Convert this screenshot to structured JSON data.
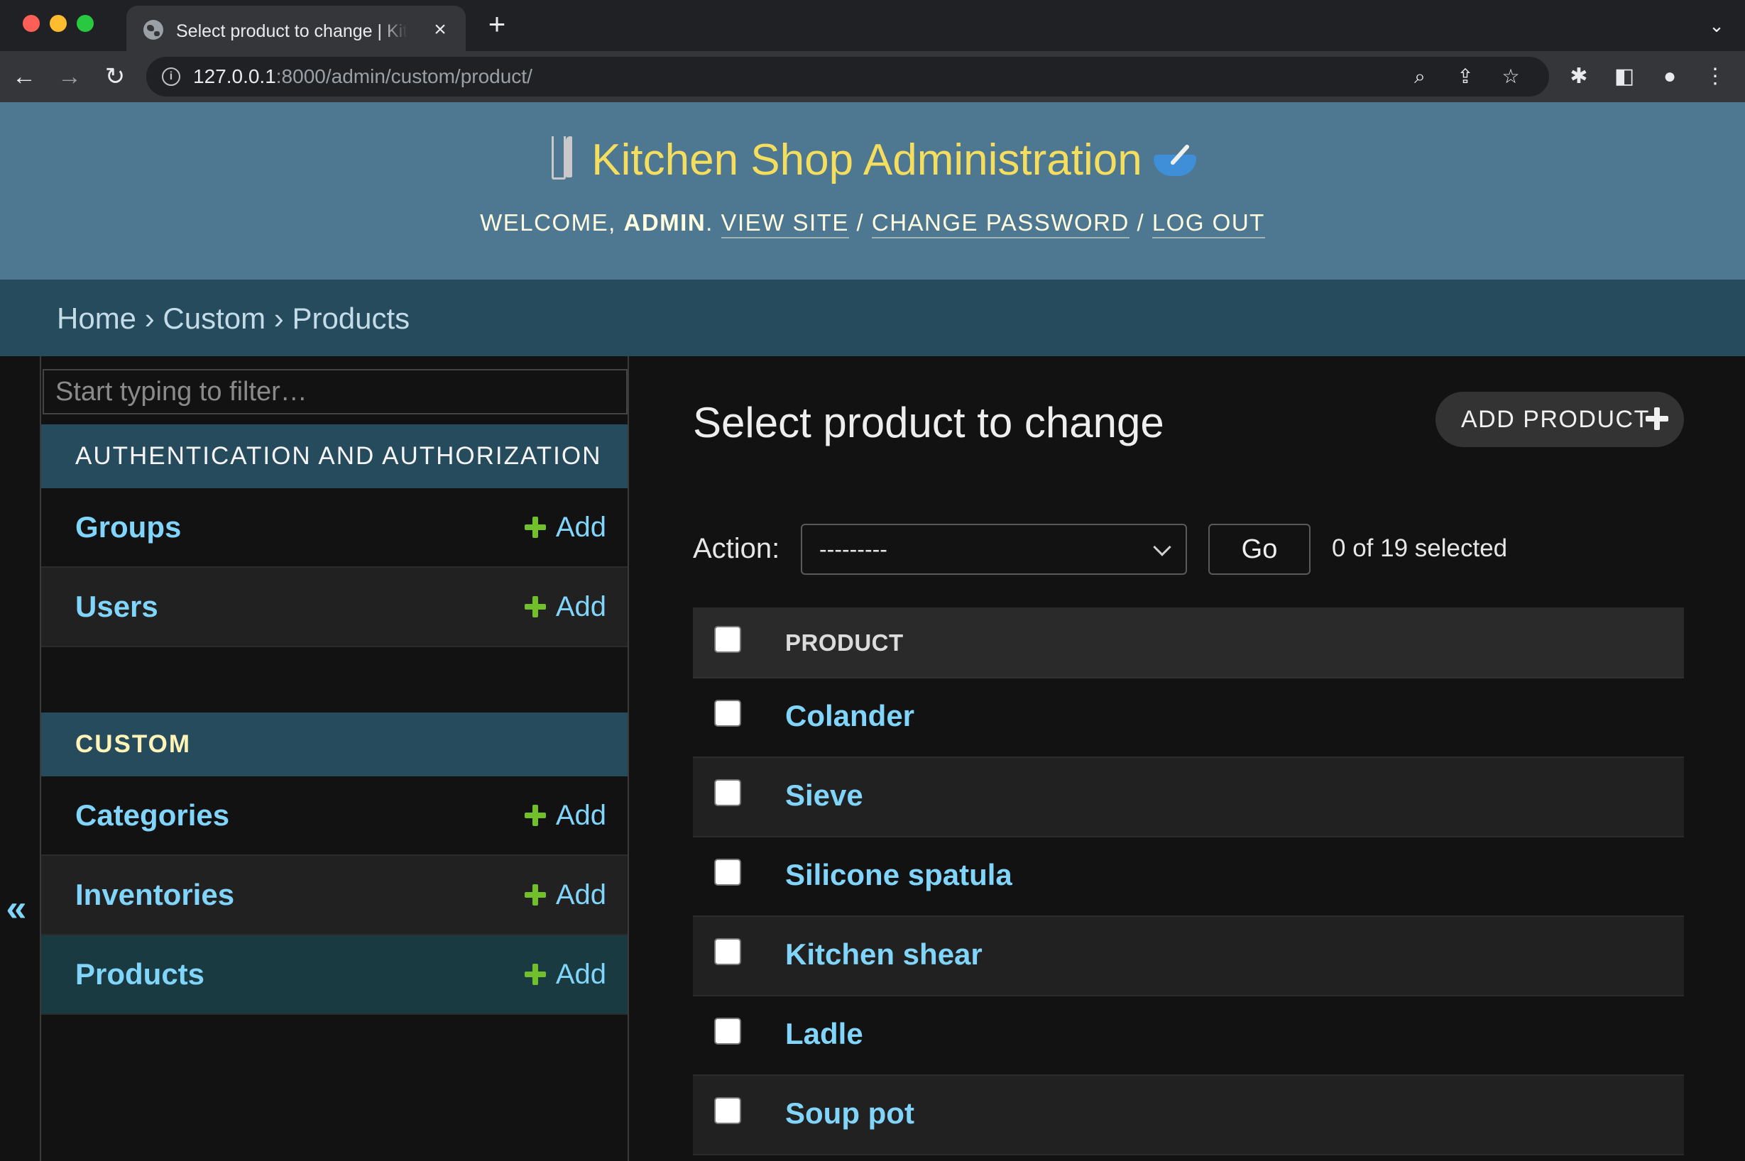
{
  "browser": {
    "tab_title": "Select product to change | Kitchen Shop Administration",
    "tab_close": "×",
    "new_tab": "+",
    "url_host": "127.0.0.1",
    "url_rest": ":8000/admin/custom/product/"
  },
  "header": {
    "site_title": "Kitchen Shop Administration",
    "welcome": "WELCOME,",
    "username": "ADMIN",
    "view_site": "VIEW SITE",
    "change_password": "CHANGE PASSWORD",
    "log_out": "LOG OUT",
    "separator": "/"
  },
  "breadcrumbs": {
    "items": [
      "Home",
      "Custom",
      "Products"
    ],
    "separator": "›"
  },
  "sidebar": {
    "filter_placeholder": "Start typing to filter…",
    "collapse_label": "«",
    "modules": [
      {
        "caption": "AUTHENTICATION AND AUTHORIZATION",
        "models": [
          {
            "name": "Groups",
            "add": "Add"
          },
          {
            "name": "Users",
            "add": "Add"
          }
        ]
      },
      {
        "caption": "CUSTOM",
        "models": [
          {
            "name": "Categories",
            "add": "Add"
          },
          {
            "name": "Inventories",
            "add": "Add"
          },
          {
            "name": "Products",
            "add": "Add",
            "active": true
          }
        ]
      }
    ]
  },
  "content": {
    "title": "Select product to change",
    "add_button": "ADD PRODUCT",
    "action_label": "Action:",
    "action_selected": "---------",
    "go_button": "Go",
    "selected_count": "0 of 19 selected",
    "column_header": "PRODUCT",
    "rows": [
      "Colander",
      "Sieve",
      "Silicone spatula",
      "Kitchen shear",
      "Ladle",
      "Soup pot"
    ]
  },
  "colors": {
    "header_bg": "#4e7892",
    "breadcrumb_bg": "#264b5d",
    "accent_yellow": "#f5dd5d",
    "link_blue": "#81d4fa",
    "add_green": "#70bf2b",
    "page_bg": "#121212"
  }
}
